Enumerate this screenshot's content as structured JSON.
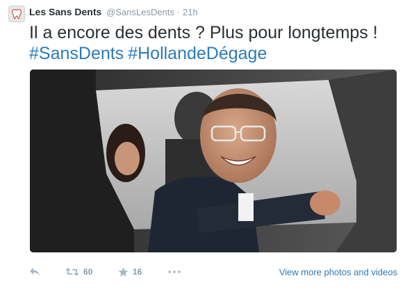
{
  "tweet": {
    "author": {
      "display_name": "Les Sans Dents",
      "handle": "@SansLesDents",
      "separator": "·",
      "timestamp": "21h",
      "avatar_icon": "tooth-icon"
    },
    "text": "Il a encore des dents ? Plus pour longtemps !",
    "hashtags": [
      "#SansDents",
      "#HollandeDégage"
    ],
    "media": {
      "type": "photo",
      "icon": "photo-man-in-car"
    },
    "actions": {
      "reply_icon": "reply-icon",
      "retweet_icon": "retweet-icon",
      "retweet_count": "60",
      "favorite_icon": "star-icon",
      "favorite_count": "16",
      "more_icon": "more-dots-icon"
    },
    "view_more_label": "View more photos and videos"
  },
  "colors": {
    "text": "#292f33",
    "muted": "#8899a6",
    "link": "#2b7bb9",
    "action_icon": "#aab8c2"
  }
}
